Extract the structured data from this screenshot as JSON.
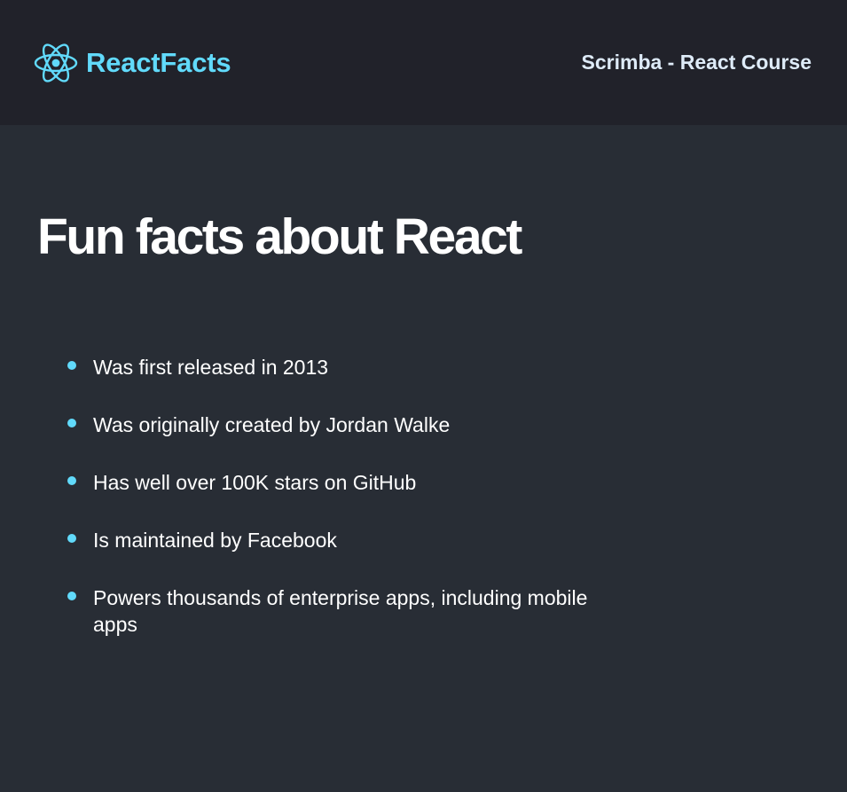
{
  "colors": {
    "accent": "#61DAFB",
    "nav_background": "#21222A",
    "page_background": "#282D35",
    "nav_text": "#DEEBF8",
    "text": "#FFFFFF"
  },
  "navbar": {
    "logo_icon": "react-atom-icon",
    "brand": "ReactFacts",
    "course": "Scrimba - React Course"
  },
  "main": {
    "title": "Fun facts about React",
    "facts": [
      "Was first released in 2013",
      "Was originally created by Jordan Walke",
      "Has well over 100K stars on GitHub",
      "Is maintained by Facebook",
      "Powers thousands of enterprise apps, including mobile apps"
    ]
  }
}
